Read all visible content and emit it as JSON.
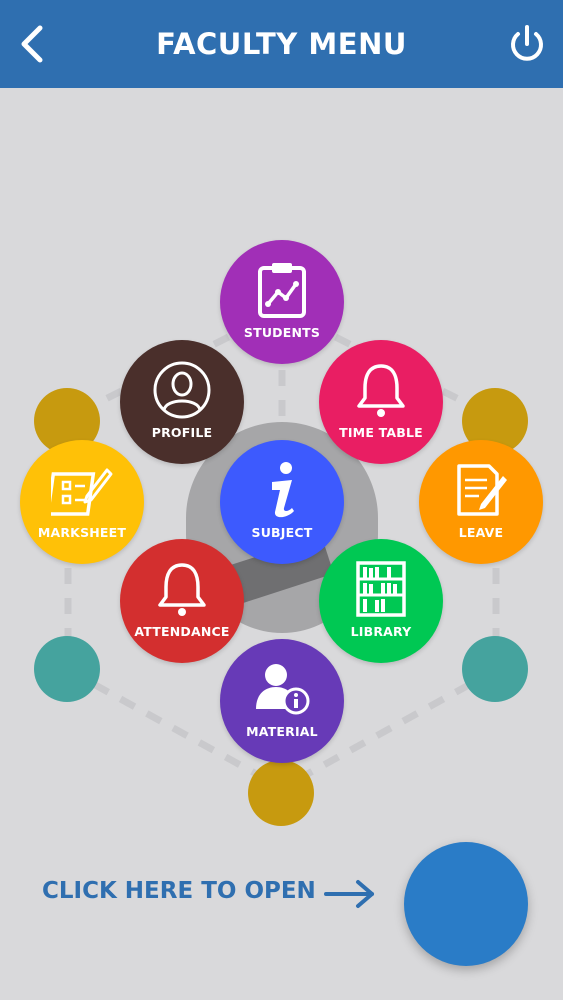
{
  "header": {
    "title": "FACULTY MENU",
    "back_icon": "chevron-left-icon",
    "power_icon": "power-icon",
    "color": "#2f6fb0"
  },
  "menu": {
    "items": [
      {
        "label": "STUDENTS",
        "icon": "clipboard-chart-icon",
        "color": "#a12fb7"
      },
      {
        "label": "PROFILE",
        "icon": "user-outline-icon",
        "color": "#4a2f2b"
      },
      {
        "label": "TIME TABLE",
        "icon": "bell-icon",
        "color": "#e91e63"
      },
      {
        "label": "MARKSHEET",
        "icon": "checklist-icon",
        "color": "#ffc107"
      },
      {
        "label": "SUBJECT",
        "icon": "info-icon",
        "color": "#3d5afe"
      },
      {
        "label": "LEAVE",
        "icon": "document-pen-icon",
        "color": "#ff9800"
      },
      {
        "label": "ATTENDANCE",
        "icon": "bell-icon",
        "color": "#d32f2f"
      },
      {
        "label": "LIBRARY",
        "icon": "bookshelf-icon",
        "color": "#00c853"
      },
      {
        "label": "MATERIAL",
        "icon": "user-info-icon",
        "color": "#673ab7"
      }
    ]
  },
  "cta": {
    "text": "CLICK HERE TO OPEN",
    "arrow_icon": "arrow-right-icon",
    "fab_color": "#2a7cc7"
  }
}
